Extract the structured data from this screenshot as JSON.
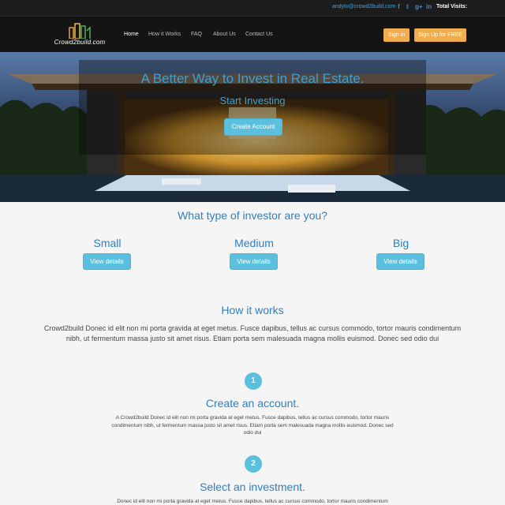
{
  "topbar": {
    "email": "andylo@crowd2build.com",
    "social": [
      {
        "icon": "facebook-icon",
        "glyph": "f"
      },
      {
        "icon": "twitter-icon",
        "glyph": "t"
      },
      {
        "icon": "google-plus-icon",
        "glyph": "g+"
      },
      {
        "icon": "linkedin-icon",
        "glyph": "in"
      }
    ],
    "total_visits_label": "Total Visits:"
  },
  "nav": {
    "logo_text": "Crowd2build.com",
    "links": [
      "Home",
      "How it Works",
      "FAQ",
      "About Us",
      "Contact Us"
    ],
    "active": "Home",
    "sign_in": "Sign in",
    "sign_up": "Sign Up for FREE"
  },
  "hero": {
    "title": "A Better Way to Invest in Real Estate.",
    "subtitle": "Start Investing",
    "cta": "Create Account"
  },
  "investor": {
    "title": "What type of investor are you?",
    "types": [
      {
        "label": "Small",
        "button": "View details"
      },
      {
        "label": "Medium",
        "button": "View details"
      },
      {
        "label": "Big",
        "button": "View details"
      }
    ]
  },
  "how": {
    "title": "How it works",
    "intro": "Crowd2build Donec id elit non mi porta gravida at eget metus. Fusce dapibus, tellus ac cursus commodo, tortor mauris condimentum nibh, ut fermentum massa justo sit amet risus. Etiam porta sem malesuada magna mollis euismod. Donec sed odio dui",
    "steps": [
      {
        "number": "1",
        "title": "Create an account.",
        "text": "A Crowd2build Donec id elit non mi porta gravida at eget metus. Fusce dapibus, tellus ac cursus commodo, tortor mauris condimentum nibh, ut fermentum massa justo sit amet risus. Etiam porta sem malesuada magna mollis euismod. Donec sed odio dui"
      },
      {
        "number": "2",
        "title": "Select an investment.",
        "text": "Donec id elit non mi porta gravida at eget metus. Fusce dapibus, tellus ac cursus commodo, tortor mauris condimentum"
      }
    ]
  },
  "colors": {
    "accent_blue": "#2e7fc0",
    "info_button": "#5bc0de",
    "orange_button": "#f0ad4e",
    "dark_bar": "#141414"
  }
}
